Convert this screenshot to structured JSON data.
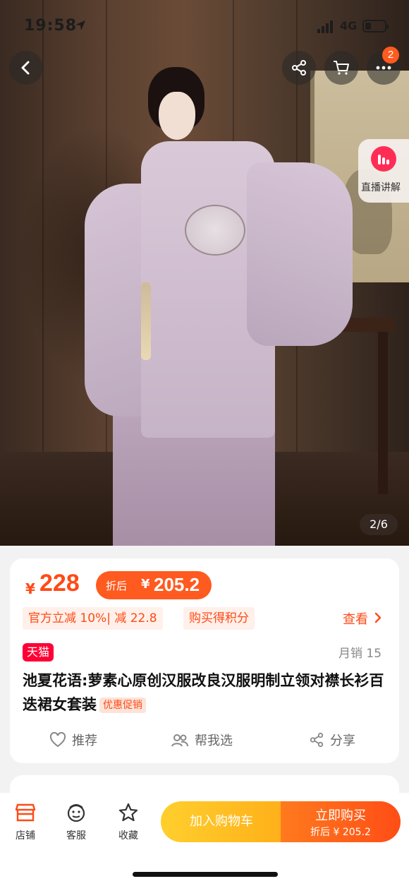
{
  "status_bar": {
    "time": "19:58",
    "network": "4G"
  },
  "top_bar": {
    "cart_badge": "2"
  },
  "live": {
    "label": "直播讲解"
  },
  "image_counter": "2/6",
  "product": {
    "price_symbol": "¥",
    "price": "228",
    "discount_label": "折后",
    "discount_symbol": "¥",
    "discount_price": "205.2",
    "tags": [
      "官方立减 10%| 减 22.8",
      "购买得积分"
    ],
    "view_label": "查看",
    "store_badge": "天猫",
    "monthly_sales": "月销 15",
    "title": "池夏花语:萝素心原创汉服改良汉服明制立领对襟长衫百迭裙女套装",
    "promo_tag": "优惠促销",
    "actions": {
      "recommend": "推荐",
      "help_choose": "帮我选",
      "share": "分享"
    }
  },
  "bottom_bar": {
    "tabs": [
      "店铺",
      "客服",
      "收藏"
    ],
    "add_to_cart": "加入购物车",
    "buy_now": "立即购买",
    "buy_now_sub": "折后 ¥ 205.2"
  },
  "colors": {
    "accent": "#ff4a16",
    "tmall": "#ff0036",
    "cart_button": "#ffb01a",
    "buy_button": "#ff4d16"
  }
}
